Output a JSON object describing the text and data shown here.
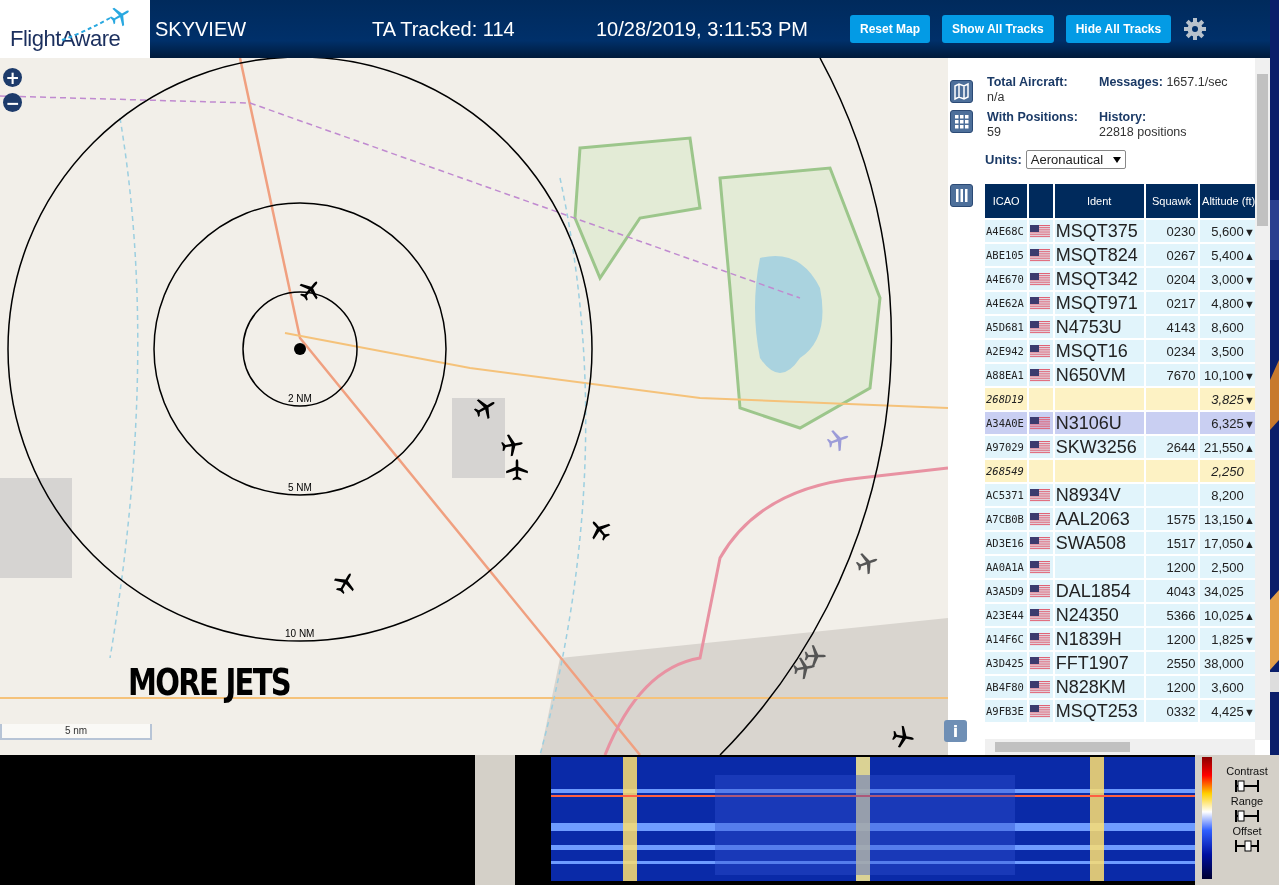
{
  "header": {
    "logo": "FlightAware",
    "title": "SKYVIEW",
    "tracked": "TA Tracked: 114",
    "datetime": "10/28/2019, 3:11:53 PM",
    "buttons": [
      "Reset Map",
      "Show All Tracks",
      "Hide All Tracks"
    ]
  },
  "map": {
    "zoom_buttons": [
      "+",
      "−"
    ],
    "ring_labels": [
      "2 NM",
      "5 NM",
      "10 NM"
    ],
    "scale": "5 nm",
    "caption": "MORE JETS",
    "info_button": "i"
  },
  "stats": [
    {
      "label": "Total Aircraft:",
      "value": "n/a"
    },
    {
      "label": "Messages:",
      "value": "1657.1/sec"
    },
    {
      "label": "With Positions:",
      "value": "59"
    },
    {
      "label": "History:",
      "value": "22818 positions"
    }
  ],
  "units": {
    "label": "Units:",
    "value": "Aeronautical"
  },
  "table": {
    "columns": [
      "ICAO",
      "",
      "Ident",
      "Squawk",
      "Altitude (ft)"
    ],
    "rows": [
      {
        "kind": "aircraft",
        "selected": false,
        "flag": true,
        "icao": "A4E68C",
        "ident": "MSQT375",
        "squawk": "0230",
        "altitude": "5,600",
        "trend": "▼"
      },
      {
        "kind": "aircraft",
        "selected": false,
        "flag": true,
        "icao": "ABE105",
        "ident": "MSQT824",
        "squawk": "0267",
        "altitude": "5,400",
        "trend": "▲"
      },
      {
        "kind": "aircraft",
        "selected": false,
        "flag": true,
        "icao": "A4E670",
        "ident": "MSQT342",
        "squawk": "0204",
        "altitude": "3,000",
        "trend": "▼"
      },
      {
        "kind": "aircraft",
        "selected": false,
        "flag": true,
        "icao": "A4E62A",
        "ident": "MSQT971",
        "squawk": "0217",
        "altitude": "4,800",
        "trend": "▼"
      },
      {
        "kind": "aircraft",
        "selected": false,
        "flag": true,
        "icao": "A5D681",
        "ident": "N4753U",
        "squawk": "4143",
        "altitude": "8,600"
      },
      {
        "kind": "aircraft",
        "selected": false,
        "flag": true,
        "icao": "A2E942",
        "ident": "MSQT16",
        "squawk": "0234",
        "altitude": "3,500"
      },
      {
        "kind": "aircraft",
        "selected": false,
        "flag": true,
        "icao": "A88EA1",
        "ident": "N650VM",
        "squawk": "7670",
        "altitude": "10,100",
        "trend": "▼"
      },
      {
        "kind": "tisb",
        "selected": false,
        "flag": false,
        "icao": "268D19",
        "altitude": "3,825",
        "trend": "▼"
      },
      {
        "kind": "aircraft",
        "selected": true,
        "flag": true,
        "icao": "A34A0E",
        "ident": "N3106U",
        "altitude": "6,325",
        "trend": "▼"
      },
      {
        "kind": "aircraft",
        "selected": false,
        "flag": true,
        "icao": "A97029",
        "ident": "SKW3256",
        "squawk": "2644",
        "altitude": "21,550",
        "trend": "▲"
      },
      {
        "kind": "tisb",
        "selected": false,
        "flag": false,
        "icao": "268549",
        "altitude": "2,250"
      },
      {
        "kind": "aircraft",
        "selected": false,
        "flag": true,
        "icao": "AC5371",
        "ident": "N8934V",
        "altitude": "8,200"
      },
      {
        "kind": "aircraft",
        "selected": false,
        "flag": true,
        "icao": "A7CB0B",
        "ident": "AAL2063",
        "squawk": "1575",
        "altitude": "13,150",
        "trend": "▲"
      },
      {
        "kind": "aircraft",
        "selected": false,
        "flag": true,
        "icao": "AD3E16",
        "ident": "SWA508",
        "squawk": "1517",
        "altitude": "17,050",
        "trend": "▲"
      },
      {
        "kind": "aircraft",
        "selected": false,
        "flag": true,
        "icao": "AA0A1A",
        "squawk": "1200",
        "altitude": "2,500"
      },
      {
        "kind": "aircraft",
        "selected": false,
        "flag": true,
        "icao": "A3A5D9",
        "ident": "DAL1854",
        "squawk": "4043",
        "altitude": "34,025"
      },
      {
        "kind": "aircraft",
        "selected": false,
        "flag": true,
        "icao": "A23E44",
        "ident": "N24350",
        "squawk": "5366",
        "altitude": "10,025",
        "trend": "▲"
      },
      {
        "kind": "aircraft",
        "selected": false,
        "flag": true,
        "icao": "A14F6C",
        "ident": "N1839H",
        "squawk": "1200",
        "altitude": "1,825",
        "trend": "▼"
      },
      {
        "kind": "aircraft",
        "selected": false,
        "flag": true,
        "icao": "A3D425",
        "ident": "FFT1907",
        "squawk": "2550",
        "altitude": "38,000"
      },
      {
        "kind": "aircraft",
        "selected": false,
        "flag": true,
        "icao": "AB4F80",
        "ident": "N828KM",
        "squawk": "1200",
        "altitude": "3,600"
      },
      {
        "kind": "aircraft",
        "selected": false,
        "flag": true,
        "icao": "A9FB3E",
        "ident": "MSQT253",
        "squawk": "0332",
        "altitude": "4,425",
        "trend": "▼"
      }
    ]
  },
  "spectrum": {
    "controls": [
      "Contrast",
      "Range",
      "Offset"
    ]
  }
}
